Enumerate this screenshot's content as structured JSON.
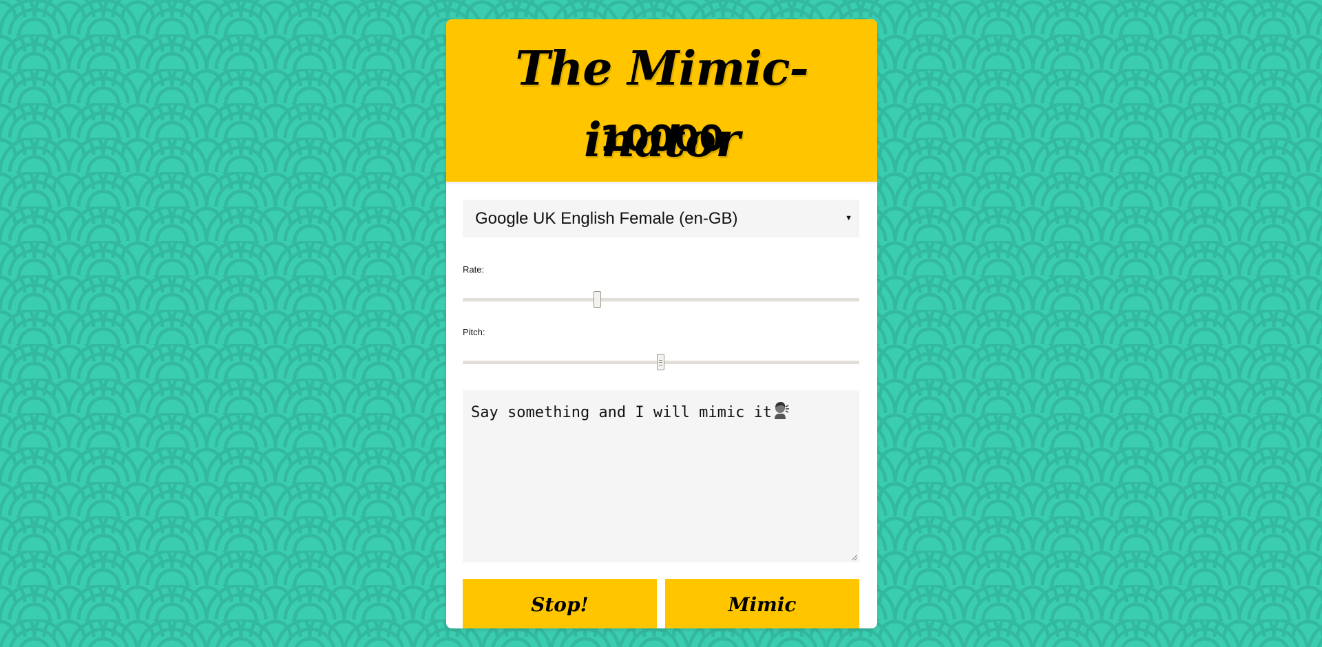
{
  "app": {
    "title": "The Mimic-inator",
    "count": "10000"
  },
  "voice": {
    "selected": "Google UK English Female (en-GB)"
  },
  "rate": {
    "label": "Rate:",
    "fraction": 0.34
  },
  "pitch": {
    "label": "Pitch:",
    "fraction": 0.5
  },
  "input": {
    "text": "Say something and I will mimic it",
    "trailing_icon": "speaking-head-icon"
  },
  "buttons": {
    "stop_label": "Stop!",
    "mimic_label": "Mimic"
  },
  "colors": {
    "background": "#3bcdb0",
    "pattern": "#33b99f",
    "accent": "#ffc600",
    "field": "#f5f5f5"
  }
}
